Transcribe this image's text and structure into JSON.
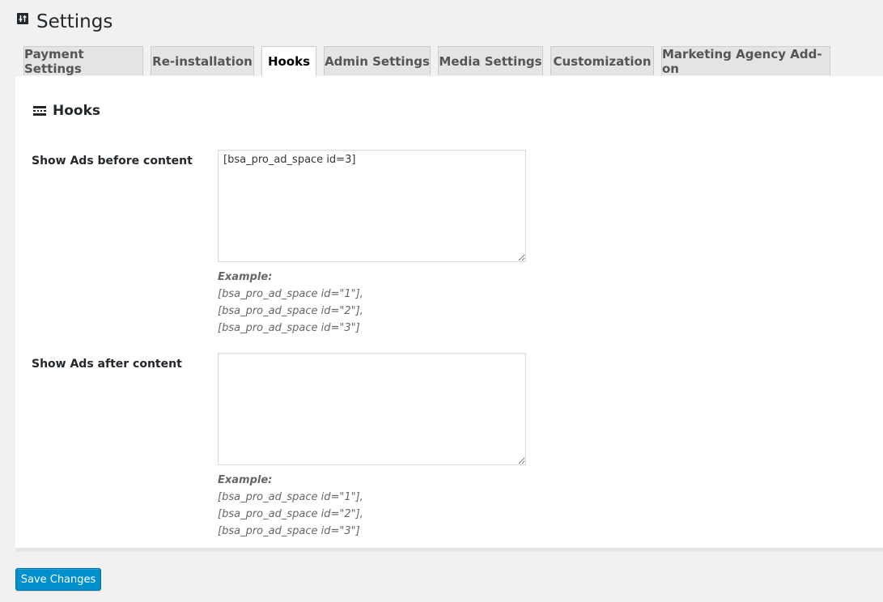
{
  "header": {
    "title": "Settings",
    "icon": "settings-sliders-icon"
  },
  "tabs": [
    {
      "label": "Payment Settings",
      "active": false
    },
    {
      "label": "Re-installation",
      "active": false
    },
    {
      "label": "Hooks",
      "active": true
    },
    {
      "label": "Admin Settings",
      "active": false
    },
    {
      "label": "Media Settings",
      "active": false
    },
    {
      "label": "Customization",
      "active": false
    },
    {
      "label": "Marketing Agency Add-on",
      "active": false
    }
  ],
  "section": {
    "title": "Hooks",
    "icon": "hooks-icon"
  },
  "fields": [
    {
      "label": "Show Ads before content",
      "value": "[bsa_pro_ad_space id=3]",
      "example_title": "Example:",
      "example_lines": [
        "[bsa_pro_ad_space id=\"1\"],",
        "[bsa_pro_ad_space id=\"2\"],",
        "[bsa_pro_ad_space id=\"3\"]"
      ]
    },
    {
      "label": "Show Ads after content",
      "value": "",
      "example_title": "Example:",
      "example_lines": [
        "[bsa_pro_ad_space id=\"1\"],",
        "[bsa_pro_ad_space id=\"2\"],",
        "[bsa_pro_ad_space id=\"3\"]"
      ]
    }
  ],
  "actions": {
    "save_label": "Save Changes"
  },
  "colors": {
    "primary_button": "#0091cd",
    "background": "#f1f1f1"
  }
}
